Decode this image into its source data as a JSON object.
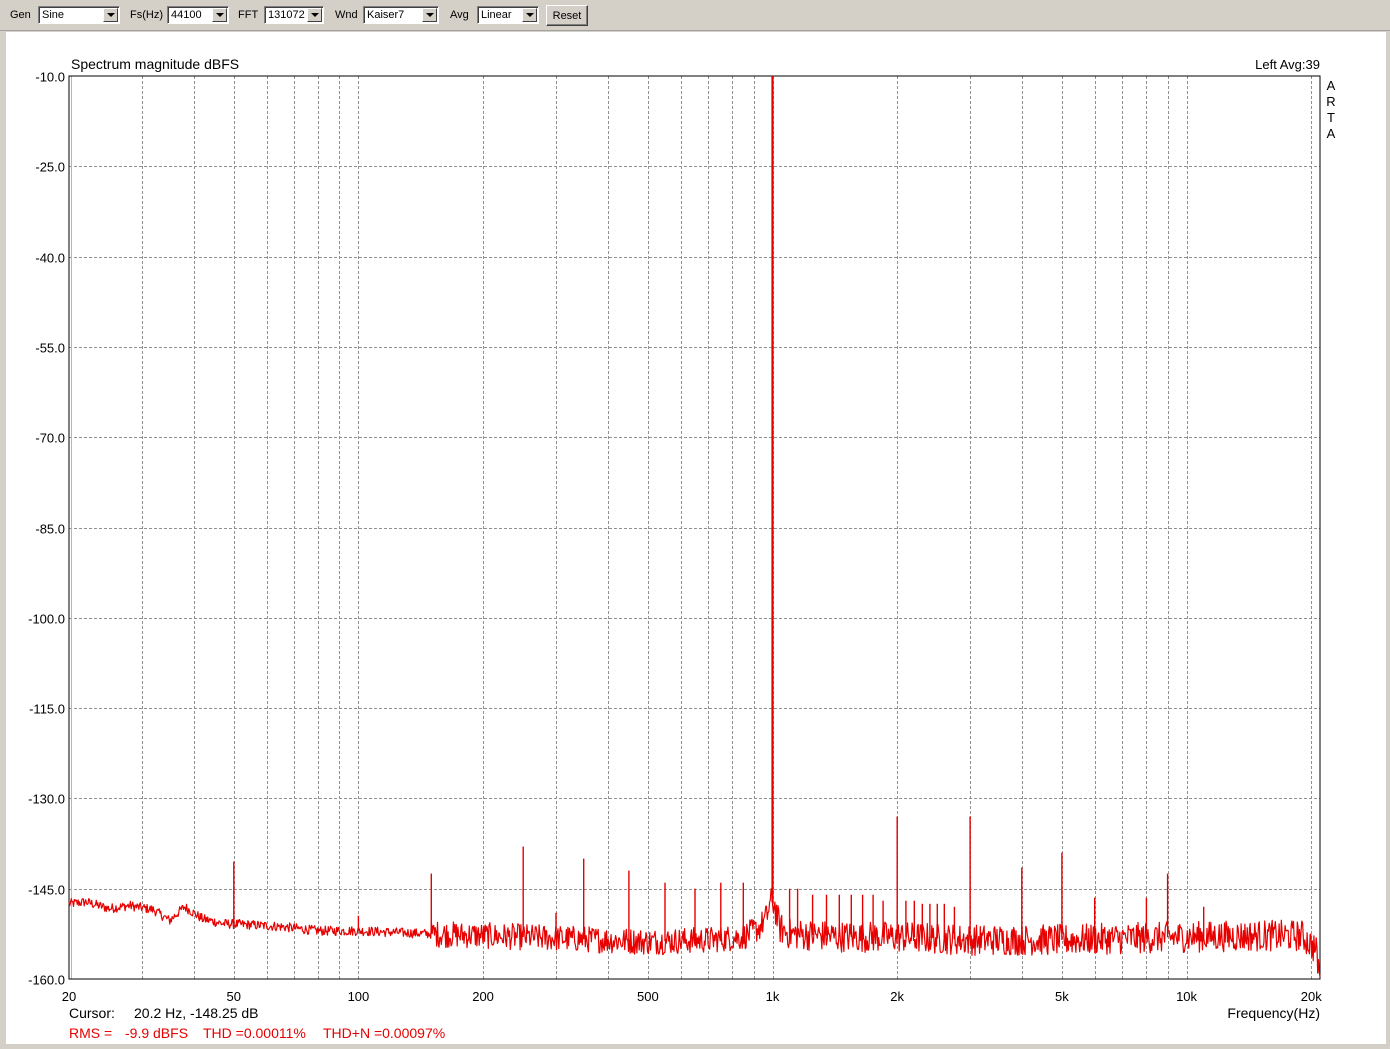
{
  "toolbar": {
    "gen_label": "Gen",
    "gen_value": "Sine",
    "fs_label": "Fs(Hz)",
    "fs_value": "44100",
    "fft_label": "FFT",
    "fft_value": "131072",
    "wnd_label": "Wnd",
    "wnd_value": "Kaiser7",
    "avg_label": "Avg",
    "avg_value": "Linear",
    "reset_label": "Reset"
  },
  "chart": {
    "channel_text": "Left  Avg:39",
    "arta_letters": [
      "A",
      "R",
      "T",
      "A"
    ],
    "cursor_label": "Cursor:",
    "cursor_value": "20.2 Hz, -148.25 dB",
    "stats_rms_label": "RMS =",
    "stats_rms_value": "-9.9 dBFS",
    "stats_thd": "THD =0.00011%",
    "stats_thdn": "THD+N =0.00097%"
  },
  "colors": {
    "trace": "#e60000",
    "stats_text": "#e60000",
    "grid": "#909090",
    "cursor_line": "#e8c000",
    "background": "#ffffff",
    "window": "#d4d0c8"
  },
  "chart_data": {
    "type": "line",
    "title": "Spectrum magnitude dBFS",
    "xlabel": "Frequency(Hz)",
    "ylabel": "",
    "x_scale": "log",
    "xlim": [
      20,
      21000
    ],
    "ylim": [
      -160,
      -10
    ],
    "grid": true,
    "x_major_ticks": [
      {
        "value": 20,
        "label": "20"
      },
      {
        "value": 50,
        "label": "50"
      },
      {
        "value": 100,
        "label": "100"
      },
      {
        "value": 200,
        "label": "200"
      },
      {
        "value": 500,
        "label": "500"
      },
      {
        "value": 1000,
        "label": "1k"
      },
      {
        "value": 2000,
        "label": "2k"
      },
      {
        "value": 5000,
        "label": "5k"
      },
      {
        "value": 10000,
        "label": "10k"
      },
      {
        "value": 20000,
        "label": "20k"
      }
    ],
    "x_minor_ticks": [
      30,
      40,
      60,
      70,
      80,
      90,
      300,
      400,
      600,
      700,
      800,
      900,
      3000,
      4000,
      6000,
      7000,
      8000,
      9000
    ],
    "y_ticks": [
      -10.0,
      -25.0,
      -40.0,
      -55.0,
      -70.0,
      -85.0,
      -100.0,
      -115.0,
      -130.0,
      -145.0,
      -160.0
    ],
    "y_tick_labels": [
      "-10.0",
      "-25.0",
      "-40.0",
      "-55.0",
      "-70.0",
      "-85.0",
      "-100.0",
      "-115.0",
      "-130.0",
      "-145.0",
      "-160.0"
    ],
    "noise_floor": [
      {
        "x": 20,
        "y": -147.5
      },
      {
        "x": 22,
        "y": -147.2
      },
      {
        "x": 25,
        "y": -148.3
      },
      {
        "x": 28,
        "y": -147.8
      },
      {
        "x": 32,
        "y": -148.5
      },
      {
        "x": 35,
        "y": -150.3
      },
      {
        "x": 38,
        "y": -148.0
      },
      {
        "x": 42,
        "y": -150.0
      },
      {
        "x": 47,
        "y": -150.8
      },
      {
        "x": 55,
        "y": -151.0
      },
      {
        "x": 65,
        "y": -151.3
      },
      {
        "x": 80,
        "y": -152.0
      },
      {
        "x": 100,
        "y": -152.0
      },
      {
        "x": 150,
        "y": -152.5
      },
      {
        "x": 200,
        "y": -152.8
      },
      {
        "x": 300,
        "y": -153.2
      },
      {
        "x": 500,
        "y": -153.8
      },
      {
        "x": 700,
        "y": -153.5
      },
      {
        "x": 850,
        "y": -153.0
      },
      {
        "x": 930,
        "y": -151.5
      },
      {
        "x": 970,
        "y": -149.5
      },
      {
        "x": 990,
        "y": -147.0
      },
      {
        "x": 1010,
        "y": -147.5
      },
      {
        "x": 1040,
        "y": -151.5
      },
      {
        "x": 1100,
        "y": -152.5
      },
      {
        "x": 1500,
        "y": -153.0
      },
      {
        "x": 2000,
        "y": -153.0
      },
      {
        "x": 3000,
        "y": -153.5
      },
      {
        "x": 5000,
        "y": -153.5
      },
      {
        "x": 10000,
        "y": -153.0
      },
      {
        "x": 15000,
        "y": -152.8
      },
      {
        "x": 19000,
        "y": -152.8
      },
      {
        "x": 20500,
        "y": -155.0
      },
      {
        "x": 21000,
        "y": -159.5
      }
    ],
    "peaks": [
      {
        "x": 50,
        "y": -140.5
      },
      {
        "x": 100,
        "y": -149.5
      },
      {
        "x": 150,
        "y": -142.5
      },
      {
        "x": 250,
        "y": -138.0
      },
      {
        "x": 300,
        "y": -149.0
      },
      {
        "x": 350,
        "y": -140.0
      },
      {
        "x": 450,
        "y": -142.0
      },
      {
        "x": 550,
        "y": -144.0
      },
      {
        "x": 650,
        "y": -145.0
      },
      {
        "x": 750,
        "y": -144.0
      },
      {
        "x": 850,
        "y": -144.0
      },
      {
        "x": 1000,
        "y": -10.0
      },
      {
        "x": 1100,
        "y": -145.0
      },
      {
        "x": 1150,
        "y": -145.0
      },
      {
        "x": 1250,
        "y": -146.0
      },
      {
        "x": 1350,
        "y": -146.0
      },
      {
        "x": 1450,
        "y": -146.0
      },
      {
        "x": 1550,
        "y": -146.0
      },
      {
        "x": 1650,
        "y": -146.0
      },
      {
        "x": 1750,
        "y": -146.0
      },
      {
        "x": 1850,
        "y": -147.0
      },
      {
        "x": 2000,
        "y": -133.0
      },
      {
        "x": 2100,
        "y": -147.0
      },
      {
        "x": 2200,
        "y": -147.0
      },
      {
        "x": 2300,
        "y": -147.5
      },
      {
        "x": 2400,
        "y": -147.5
      },
      {
        "x": 2500,
        "y": -147.5
      },
      {
        "x": 2600,
        "y": -147.5
      },
      {
        "x": 2750,
        "y": -148.0
      },
      {
        "x": 3000,
        "y": -133.0
      },
      {
        "x": 4000,
        "y": -141.5
      },
      {
        "x": 5000,
        "y": -139.0
      },
      {
        "x": 6000,
        "y": -146.5
      },
      {
        "x": 8000,
        "y": -146.5
      },
      {
        "x": 9000,
        "y": -142.5
      },
      {
        "x": 11000,
        "y": -148.0
      }
    ]
  }
}
